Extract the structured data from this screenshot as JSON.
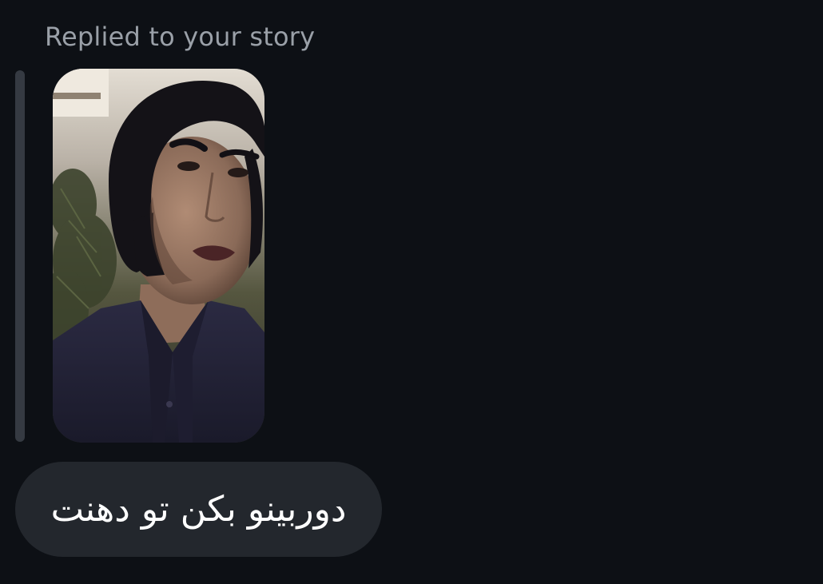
{
  "reply_header": "Replied to your story",
  "story": {
    "thumbnail_icon": "story-photo-thumbnail",
    "palette": {
      "background_light": "#d6d0c6",
      "foliage": "#3f4630",
      "hair": "#141217",
      "skin": "#9b7a66",
      "shirt": "#23223a",
      "lips": "#4a2426"
    }
  },
  "message": {
    "text": "دوربینو بکن تو دهنت"
  },
  "colors": {
    "background": "#0d1015",
    "bubble": "#23272d",
    "quote_bar": "#353a42",
    "secondary_text": "#9aa0a8"
  }
}
